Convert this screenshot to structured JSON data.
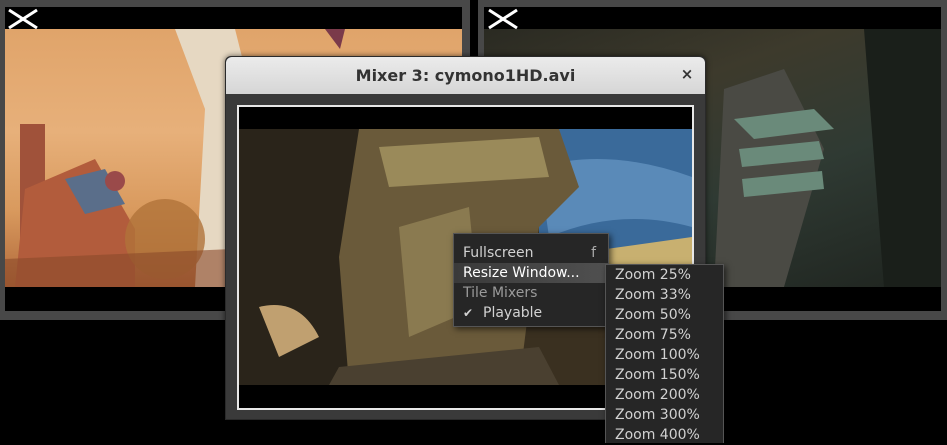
{
  "dialog": {
    "title": "Mixer 3: cymono1HD.avi",
    "close_glyph": "×"
  },
  "context_menu": {
    "items": [
      {
        "label": "Fullscreen",
        "accel": "f"
      },
      {
        "label": "Resize Window..."
      },
      {
        "label": "Tile Mixers"
      },
      {
        "label": "Playable",
        "checked": true,
        "check_glyph": "✔"
      }
    ]
  },
  "zoom_menu": {
    "items": [
      "Zoom 25%",
      "Zoom 33%",
      "Zoom 50%",
      "Zoom 75%",
      "Zoom 100%",
      "Zoom 150%",
      "Zoom 200%",
      "Zoom 300%",
      "Zoom 400%"
    ]
  },
  "icons": {
    "left_close": "close-x-icon",
    "right_close": "close-x-icon"
  }
}
